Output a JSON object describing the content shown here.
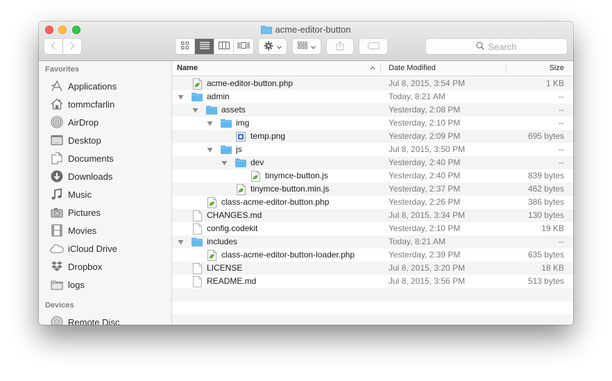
{
  "window": {
    "title": "acme-editor-button",
    "title_icon": "folder-icon"
  },
  "toolbar": {
    "back_icon": "chevron-left-icon",
    "forward_icon": "chevron-right-icon",
    "view_modes": [
      {
        "name": "icon-view",
        "icon": "grid-icon",
        "active": false
      },
      {
        "name": "list-view",
        "icon": "list-icon",
        "active": true
      },
      {
        "name": "column-view",
        "icon": "columns-icon",
        "active": false
      },
      {
        "name": "cover-flow-view",
        "icon": "coverflow-icon",
        "active": false
      }
    ],
    "action_icon": "gear-icon",
    "arrange_icon": "arrange-grid-icon",
    "share_icon": "share-icon",
    "tags_icon": "tag-icon",
    "search_placeholder": "Search"
  },
  "sidebar": {
    "sections": [
      {
        "heading": "Favorites",
        "items": [
          {
            "label": "Applications",
            "icon": "applications-icon"
          },
          {
            "label": "tommcfarlin",
            "icon": "home-icon"
          },
          {
            "label": "AirDrop",
            "icon": "airdrop-icon"
          },
          {
            "label": "Desktop",
            "icon": "desktop-icon"
          },
          {
            "label": "Documents",
            "icon": "documents-icon"
          },
          {
            "label": "Downloads",
            "icon": "downloads-icon"
          },
          {
            "label": "Music",
            "icon": "music-icon"
          },
          {
            "label": "Pictures",
            "icon": "pictures-icon"
          },
          {
            "label": "Movies",
            "icon": "movies-icon"
          },
          {
            "label": "iCloud Drive",
            "icon": "cloud-icon"
          },
          {
            "label": "Dropbox",
            "icon": "dropbox-icon"
          },
          {
            "label": "logs",
            "icon": "folder-icon"
          }
        ]
      },
      {
        "heading": "Devices",
        "items": [
          {
            "label": "Remote Disc",
            "icon": "disc-icon"
          }
        ]
      }
    ]
  },
  "columns": {
    "name": "Name",
    "date": "Date Modified",
    "size": "Size",
    "sort_icon": "chevron-up-icon"
  },
  "files": [
    {
      "name": "acme-editor-button.php",
      "date": "Jul 8, 2015, 3:54 PM",
      "size": "1 KB",
      "depth": 0,
      "type": "php",
      "expanded": null
    },
    {
      "name": "admin",
      "date": "Today, 8:21 AM",
      "size": "--",
      "depth": 0,
      "type": "folder",
      "expanded": true
    },
    {
      "name": "assets",
      "date": "Yesterday, 2:08 PM",
      "size": "--",
      "depth": 1,
      "type": "folder",
      "expanded": true
    },
    {
      "name": "img",
      "date": "Yesterday, 2:10 PM",
      "size": "--",
      "depth": 2,
      "type": "folder",
      "expanded": true
    },
    {
      "name": "temp.png",
      "date": "Yesterday, 2:09 PM",
      "size": "695 bytes",
      "depth": 3,
      "type": "image",
      "expanded": null
    },
    {
      "name": "js",
      "date": "Jul 8, 2015, 3:50 PM",
      "size": "--",
      "depth": 2,
      "type": "folder",
      "expanded": true
    },
    {
      "name": "dev",
      "date": "Yesterday, 2:40 PM",
      "size": "--",
      "depth": 3,
      "type": "folder",
      "expanded": true
    },
    {
      "name": "tinymce-button.js",
      "date": "Yesterday, 2:40 PM",
      "size": "839 bytes",
      "depth": 4,
      "type": "php",
      "expanded": null
    },
    {
      "name": "tinymce-button.min.js",
      "date": "Yesterday, 2:37 PM",
      "size": "462 bytes",
      "depth": 3,
      "type": "php",
      "expanded": null
    },
    {
      "name": "class-acme-editor-button.php",
      "date": "Yesterday, 2:26 PM",
      "size": "386 bytes",
      "depth": 1,
      "type": "php",
      "expanded": null
    },
    {
      "name": "CHANGES.md",
      "date": "Jul 8, 2015, 3:34 PM",
      "size": "130 bytes",
      "depth": 0,
      "type": "doc",
      "expanded": null
    },
    {
      "name": "config.codekit",
      "date": "Yesterday, 2:10 PM",
      "size": "19 KB",
      "depth": 0,
      "type": "doc",
      "expanded": null
    },
    {
      "name": "includes",
      "date": "Today, 8:21 AM",
      "size": "--",
      "depth": 0,
      "type": "folder",
      "expanded": true
    },
    {
      "name": "class-acme-editor-button-loader.php",
      "date": "Yesterday, 2:39 PM",
      "size": "635 bytes",
      "depth": 1,
      "type": "php",
      "expanded": null
    },
    {
      "name": "LICENSE",
      "date": "Jul 8, 2015, 3:20 PM",
      "size": "18 KB",
      "depth": 0,
      "type": "doc",
      "expanded": null
    },
    {
      "name": "README.md",
      "date": "Jul 8, 2015, 3:56 PM",
      "size": "513 bytes",
      "depth": 0,
      "type": "doc",
      "expanded": null
    }
  ],
  "colors": {
    "folder_blue": "#62b9ef",
    "leaf_green": "#5ab534",
    "close": "#fc605c",
    "minimize": "#fdbc40",
    "zoom": "#34c84a"
  }
}
